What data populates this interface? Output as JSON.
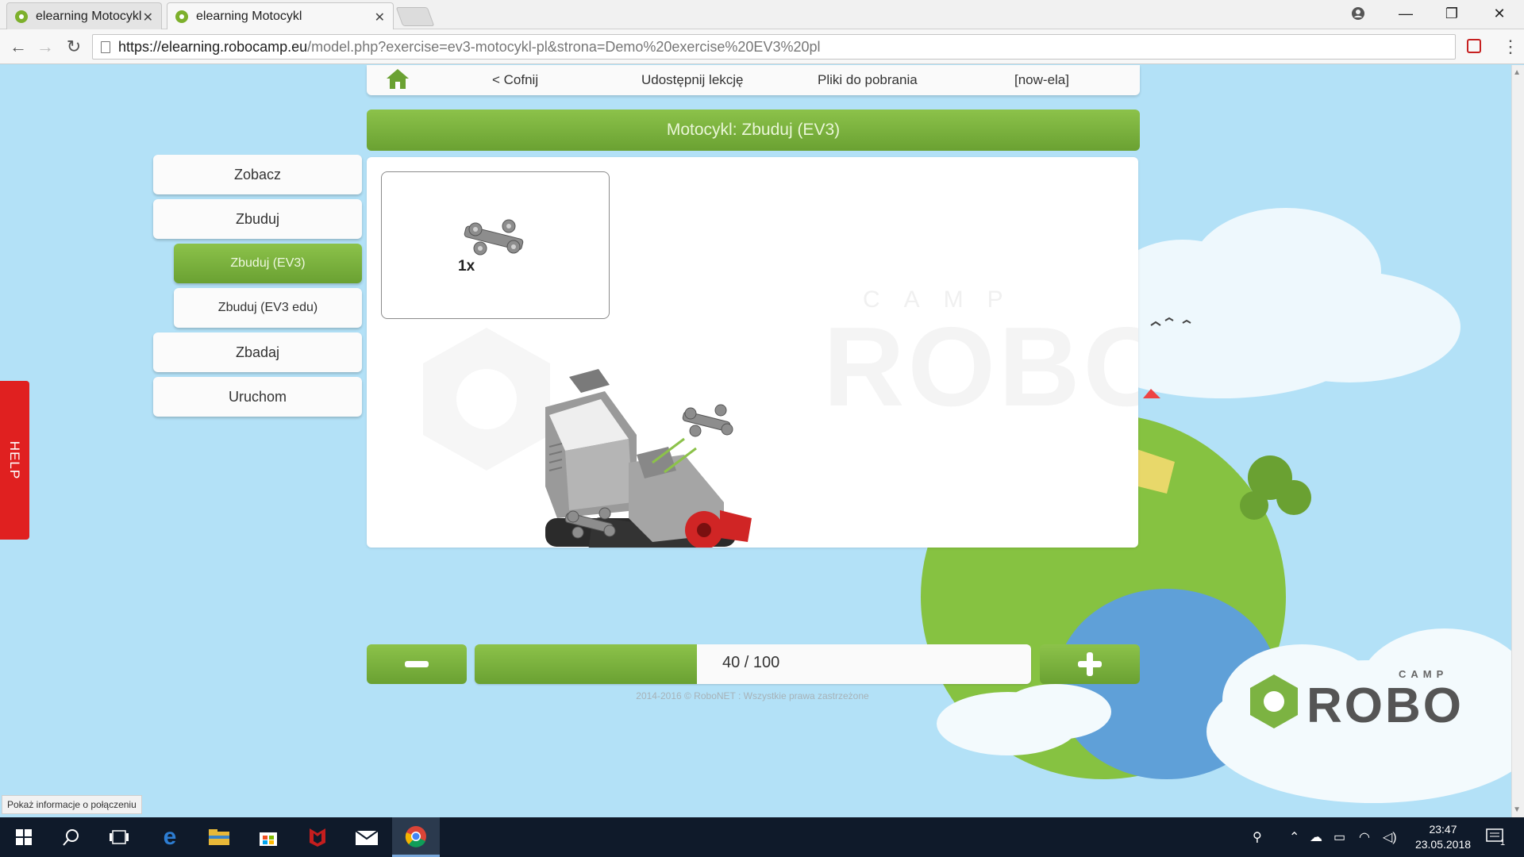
{
  "browser": {
    "tabs": [
      {
        "title": "elearning Motocykl",
        "active": false
      },
      {
        "title": "elearning Motocykl",
        "active": true
      }
    ],
    "url_host": "https://elearning.robocamp.eu",
    "url_path": "/model.php?exercise=ev3-motocykl-pl&strona=Demo%20exercise%20EV3%20pl",
    "status_text": "Pokaż informacje o połączeniu"
  },
  "topnav": {
    "back": "< Cofnij",
    "share": "Udostępnij lekcję",
    "downloads": "Pliki do pobrania",
    "user": "[now-ela]"
  },
  "title": "Motocykl: Zbuduj (EV3)",
  "sidebar": {
    "items": [
      {
        "label": "Zobacz"
      },
      {
        "label": "Zbuduj"
      },
      {
        "label": "Zbuduj (EV3)",
        "selected": true
      },
      {
        "label": "Zbuduj (EV3 edu)"
      },
      {
        "label": "Zbadaj"
      },
      {
        "label": "Uruchom"
      }
    ]
  },
  "parts": {
    "quantity": "1x"
  },
  "watermark": {
    "word": "ROBO",
    "camp": "CAMP"
  },
  "progress": {
    "label": "40 / 100",
    "current": 40,
    "total": 100
  },
  "copyright": "2014-2016 © RoboNET : Wszystkie prawa zastrzeżone",
  "help": "HELP",
  "brand": {
    "word": "ROBO",
    "camp": "CAMP"
  },
  "taskbar": {
    "time": "23:47",
    "date": "23.05.2018",
    "notifications": "1"
  },
  "colors": {
    "accent_green": "#7cb342",
    "help_red": "#e02020",
    "sky": "#b3e1f7"
  }
}
